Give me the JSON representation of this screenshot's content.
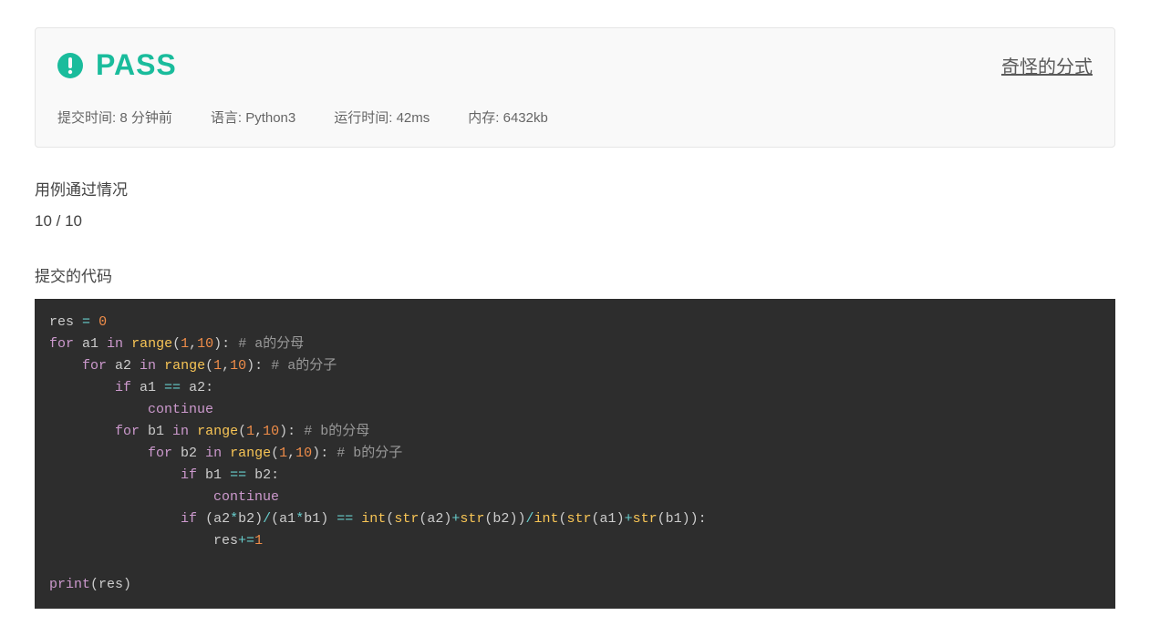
{
  "status": {
    "result": "PASS",
    "icon_name": "exclamation-circle-icon"
  },
  "problem": {
    "title": "奇怪的分式"
  },
  "meta": {
    "submit_time_label": "提交时间:",
    "submit_time_value": "8 分钟前",
    "language_label": "语言:",
    "language_value": "Python3",
    "runtime_label": "运行时间:",
    "runtime_value": "42ms",
    "memory_label": "内存:",
    "memory_value": "6432kb"
  },
  "testcase": {
    "title": "用例通过情况",
    "result": "10 / 10"
  },
  "code": {
    "title": "提交的代码",
    "lines": [
      [
        {
          "t": "ident",
          "v": "res"
        },
        {
          "t": "plain",
          "v": " "
        },
        {
          "t": "op",
          "v": "="
        },
        {
          "t": "plain",
          "v": " "
        },
        {
          "t": "num",
          "v": "0"
        }
      ],
      [
        {
          "t": "kw",
          "v": "for"
        },
        {
          "t": "plain",
          "v": " a1 "
        },
        {
          "t": "kw",
          "v": "in"
        },
        {
          "t": "plain",
          "v": " "
        },
        {
          "t": "func",
          "v": "range"
        },
        {
          "t": "punct",
          "v": "("
        },
        {
          "t": "num",
          "v": "1"
        },
        {
          "t": "punct",
          "v": ","
        },
        {
          "t": "num",
          "v": "10"
        },
        {
          "t": "punct",
          "v": ")"
        },
        {
          "t": "punct",
          "v": ":"
        },
        {
          "t": "plain",
          "v": " "
        },
        {
          "t": "comment",
          "v": "# a的分母"
        }
      ],
      [
        {
          "t": "plain",
          "v": "    "
        },
        {
          "t": "kw",
          "v": "for"
        },
        {
          "t": "plain",
          "v": " a2 "
        },
        {
          "t": "kw",
          "v": "in"
        },
        {
          "t": "plain",
          "v": " "
        },
        {
          "t": "func",
          "v": "range"
        },
        {
          "t": "punct",
          "v": "("
        },
        {
          "t": "num",
          "v": "1"
        },
        {
          "t": "punct",
          "v": ","
        },
        {
          "t": "num",
          "v": "10"
        },
        {
          "t": "punct",
          "v": ")"
        },
        {
          "t": "punct",
          "v": ":"
        },
        {
          "t": "plain",
          "v": " "
        },
        {
          "t": "comment",
          "v": "# a的分子"
        }
      ],
      [
        {
          "t": "plain",
          "v": "        "
        },
        {
          "t": "kw",
          "v": "if"
        },
        {
          "t": "plain",
          "v": " a1 "
        },
        {
          "t": "op",
          "v": "=="
        },
        {
          "t": "plain",
          "v": " a2"
        },
        {
          "t": "punct",
          "v": ":"
        }
      ],
      [
        {
          "t": "plain",
          "v": "            "
        },
        {
          "t": "kw",
          "v": "continue"
        }
      ],
      [
        {
          "t": "plain",
          "v": "        "
        },
        {
          "t": "kw",
          "v": "for"
        },
        {
          "t": "plain",
          "v": " b1 "
        },
        {
          "t": "kw",
          "v": "in"
        },
        {
          "t": "plain",
          "v": " "
        },
        {
          "t": "func",
          "v": "range"
        },
        {
          "t": "punct",
          "v": "("
        },
        {
          "t": "num",
          "v": "1"
        },
        {
          "t": "punct",
          "v": ","
        },
        {
          "t": "num",
          "v": "10"
        },
        {
          "t": "punct",
          "v": ")"
        },
        {
          "t": "punct",
          "v": ":"
        },
        {
          "t": "plain",
          "v": " "
        },
        {
          "t": "comment",
          "v": "# b的分母"
        }
      ],
      [
        {
          "t": "plain",
          "v": "            "
        },
        {
          "t": "kw",
          "v": "for"
        },
        {
          "t": "plain",
          "v": " b2 "
        },
        {
          "t": "kw",
          "v": "in"
        },
        {
          "t": "plain",
          "v": " "
        },
        {
          "t": "func",
          "v": "range"
        },
        {
          "t": "punct",
          "v": "("
        },
        {
          "t": "num",
          "v": "1"
        },
        {
          "t": "punct",
          "v": ","
        },
        {
          "t": "num",
          "v": "10"
        },
        {
          "t": "punct",
          "v": ")"
        },
        {
          "t": "punct",
          "v": ":"
        },
        {
          "t": "plain",
          "v": " "
        },
        {
          "t": "comment",
          "v": "# b的分子"
        }
      ],
      [
        {
          "t": "plain",
          "v": "                "
        },
        {
          "t": "kw",
          "v": "if"
        },
        {
          "t": "plain",
          "v": " b1 "
        },
        {
          "t": "op",
          "v": "=="
        },
        {
          "t": "plain",
          "v": " b2"
        },
        {
          "t": "punct",
          "v": ":"
        }
      ],
      [
        {
          "t": "plain",
          "v": "                    "
        },
        {
          "t": "kw",
          "v": "continue"
        }
      ],
      [
        {
          "t": "plain",
          "v": "                "
        },
        {
          "t": "kw",
          "v": "if"
        },
        {
          "t": "plain",
          "v": " "
        },
        {
          "t": "punct",
          "v": "("
        },
        {
          "t": "plain",
          "v": "a2"
        },
        {
          "t": "op",
          "v": "*"
        },
        {
          "t": "plain",
          "v": "b2"
        },
        {
          "t": "punct",
          "v": ")"
        },
        {
          "t": "op",
          "v": "/"
        },
        {
          "t": "punct",
          "v": "("
        },
        {
          "t": "plain",
          "v": "a1"
        },
        {
          "t": "op",
          "v": "*"
        },
        {
          "t": "plain",
          "v": "b1"
        },
        {
          "t": "punct",
          "v": ")"
        },
        {
          "t": "plain",
          "v": " "
        },
        {
          "t": "op",
          "v": "=="
        },
        {
          "t": "plain",
          "v": " "
        },
        {
          "t": "func",
          "v": "int"
        },
        {
          "t": "punct",
          "v": "("
        },
        {
          "t": "func",
          "v": "str"
        },
        {
          "t": "punct",
          "v": "("
        },
        {
          "t": "plain",
          "v": "a2"
        },
        {
          "t": "punct",
          "v": ")"
        },
        {
          "t": "op",
          "v": "+"
        },
        {
          "t": "func",
          "v": "str"
        },
        {
          "t": "punct",
          "v": "("
        },
        {
          "t": "plain",
          "v": "b2"
        },
        {
          "t": "punct",
          "v": ")"
        },
        {
          "t": "punct",
          "v": ")"
        },
        {
          "t": "op",
          "v": "/"
        },
        {
          "t": "func",
          "v": "int"
        },
        {
          "t": "punct",
          "v": "("
        },
        {
          "t": "func",
          "v": "str"
        },
        {
          "t": "punct",
          "v": "("
        },
        {
          "t": "plain",
          "v": "a1"
        },
        {
          "t": "punct",
          "v": ")"
        },
        {
          "t": "op",
          "v": "+"
        },
        {
          "t": "func",
          "v": "str"
        },
        {
          "t": "punct",
          "v": "("
        },
        {
          "t": "plain",
          "v": "b1"
        },
        {
          "t": "punct",
          "v": ")"
        },
        {
          "t": "punct",
          "v": ")"
        },
        {
          "t": "punct",
          "v": ":"
        }
      ],
      [
        {
          "t": "plain",
          "v": "                    "
        },
        {
          "t": "plain",
          "v": "res"
        },
        {
          "t": "op",
          "v": "+="
        },
        {
          "t": "num",
          "v": "1"
        }
      ],
      [],
      [
        {
          "t": "kw",
          "v": "print"
        },
        {
          "t": "punct",
          "v": "("
        },
        {
          "t": "plain",
          "v": "res"
        },
        {
          "t": "punct",
          "v": ")"
        }
      ]
    ]
  }
}
